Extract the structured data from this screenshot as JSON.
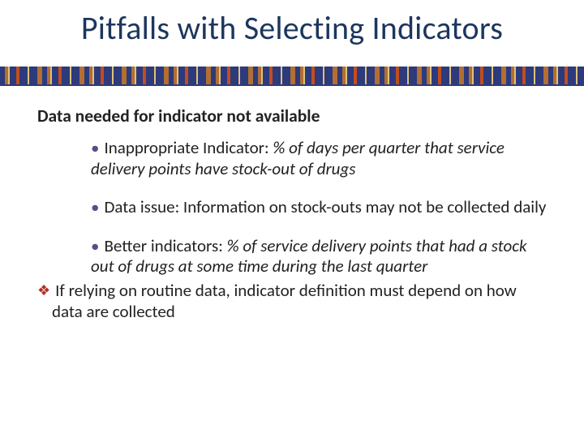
{
  "title": "Pitfalls with Selecting Indicators",
  "subhead": "Data needed for indicator not available",
  "bullets": [
    {
      "label": "Inappropriate Indicator: ",
      "example": "% of days per quarter that service delivery points have stock-out of drugs"
    },
    {
      "text": "Data issue: Information on stock-outs may not be collected daily"
    },
    {
      "label": "Better indicators: ",
      "example": "% of service delivery points that had a stock out of drugs at some time during the last quarter"
    }
  ],
  "summary": "If relying on routine data, indicator definition must depend on how data are collected"
}
